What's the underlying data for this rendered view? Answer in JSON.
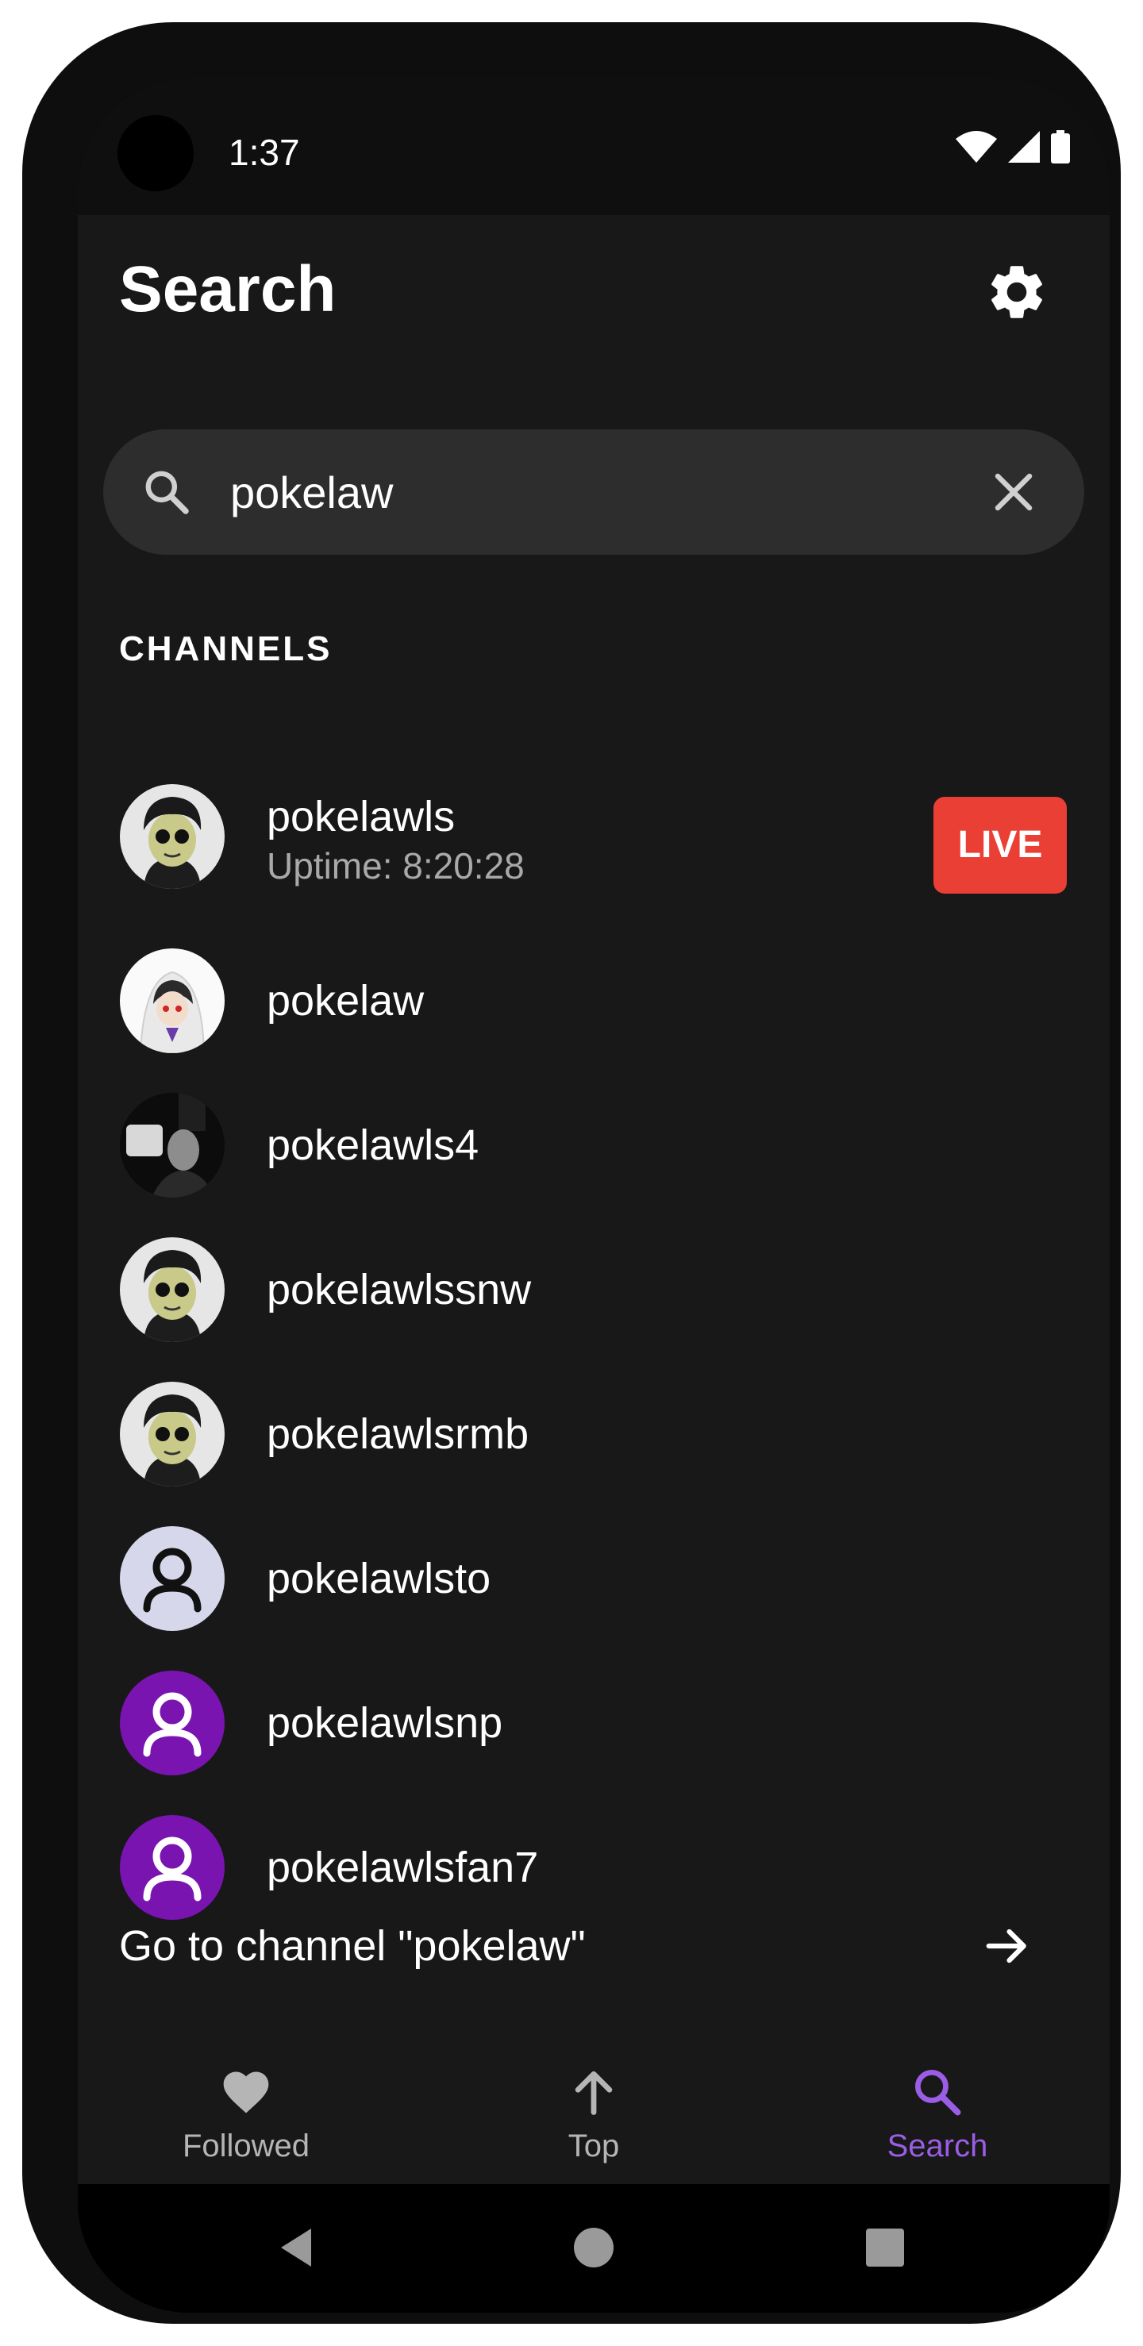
{
  "status_bar": {
    "time": "1:37",
    "icons": [
      "wifi-icon",
      "signal-icon",
      "battery-icon"
    ]
  },
  "header": {
    "title": "Search",
    "settings_icon": "gear-icon"
  },
  "search": {
    "value": "pokelaw",
    "placeholder": "Search",
    "icon": "search-icon",
    "clear_icon": "close-icon"
  },
  "channels": {
    "header": "CHANNELS",
    "items": [
      {
        "name": "pokelawls",
        "subtitle": "Uptime: 8:20:28",
        "live": "LIVE",
        "avatar": "anime-avatar"
      },
      {
        "name": "pokelaw",
        "avatar": "anime-avatar"
      },
      {
        "name": "pokelawls4",
        "avatar": "photo-avatar"
      },
      {
        "name": "pokelawlssnw",
        "avatar": "anime-avatar"
      },
      {
        "name": "pokelawlsrmb",
        "avatar": "anime-avatar"
      },
      {
        "name": "pokelawlsto",
        "avatar": "default-user-avatar"
      },
      {
        "name": "pokelawlsnp",
        "avatar": "default-user-avatar"
      },
      {
        "name": "pokelawlsfan7",
        "avatar": "default-user-avatar"
      }
    ]
  },
  "goto": {
    "label": "Go to channel \"pokelaw\"",
    "icon": "arrow-right-icon"
  },
  "bottom_nav": {
    "items": [
      {
        "label": "Followed",
        "icon": "heart-icon"
      },
      {
        "label": "Top",
        "icon": "arrow-up-icon"
      },
      {
        "label": "Search",
        "icon": "search-icon",
        "active": true
      }
    ]
  },
  "colors": {
    "background": "#181818",
    "live": "#ea3f35",
    "accent": "#9b5de5",
    "inactive": "#b5b5b5",
    "avatar_purple": "#7a14b0",
    "avatar_lavender": "#d6d7ea"
  }
}
